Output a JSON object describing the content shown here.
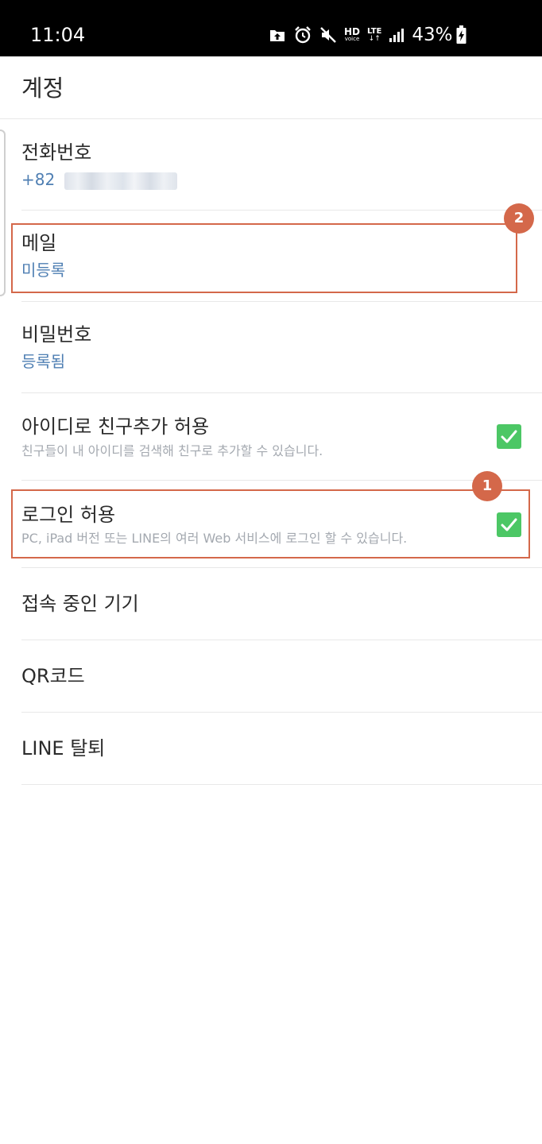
{
  "status_bar": {
    "time": "11:04",
    "hd_main": "HD",
    "hd_sub": "voice",
    "lte_main": "LTE",
    "lte_sub": "↓↑",
    "battery_percent": "43%",
    "icons": [
      "upload-icon",
      "alarm-icon",
      "mute-icon",
      "signal-icon",
      "battery-charging-icon"
    ]
  },
  "header": {
    "title": "계정"
  },
  "settings": {
    "phone": {
      "title": "전화번호",
      "value_prefix": "+82"
    },
    "email": {
      "title": "메일",
      "value": "미등록"
    },
    "password": {
      "title": "비밀번호",
      "value": "등록됨"
    },
    "allow_add_by_id": {
      "title": "아이디로 친구추가 허용",
      "description": "친구들이 내 아이디를 검색해 친구로 추가할 수 있습니다.",
      "checked": true
    },
    "allow_login": {
      "title": "로그인 허용",
      "description": "PC, iPad 버전 또는 LINE의 여러 Web 서비스에 로그인 할 수 있습니다.",
      "checked": true
    },
    "connected_devices": {
      "title": "접속 중인 기기"
    },
    "qr_code": {
      "title": "QR코드"
    },
    "delete_account": {
      "title": "LINE 탈퇴"
    }
  },
  "annotations": {
    "badge_1": "1",
    "badge_2": "2",
    "color": "#d4684a"
  },
  "colors": {
    "accent_value": "#4f7fb3",
    "checkbox": "#4cc765",
    "description": "#a4a9b0"
  }
}
